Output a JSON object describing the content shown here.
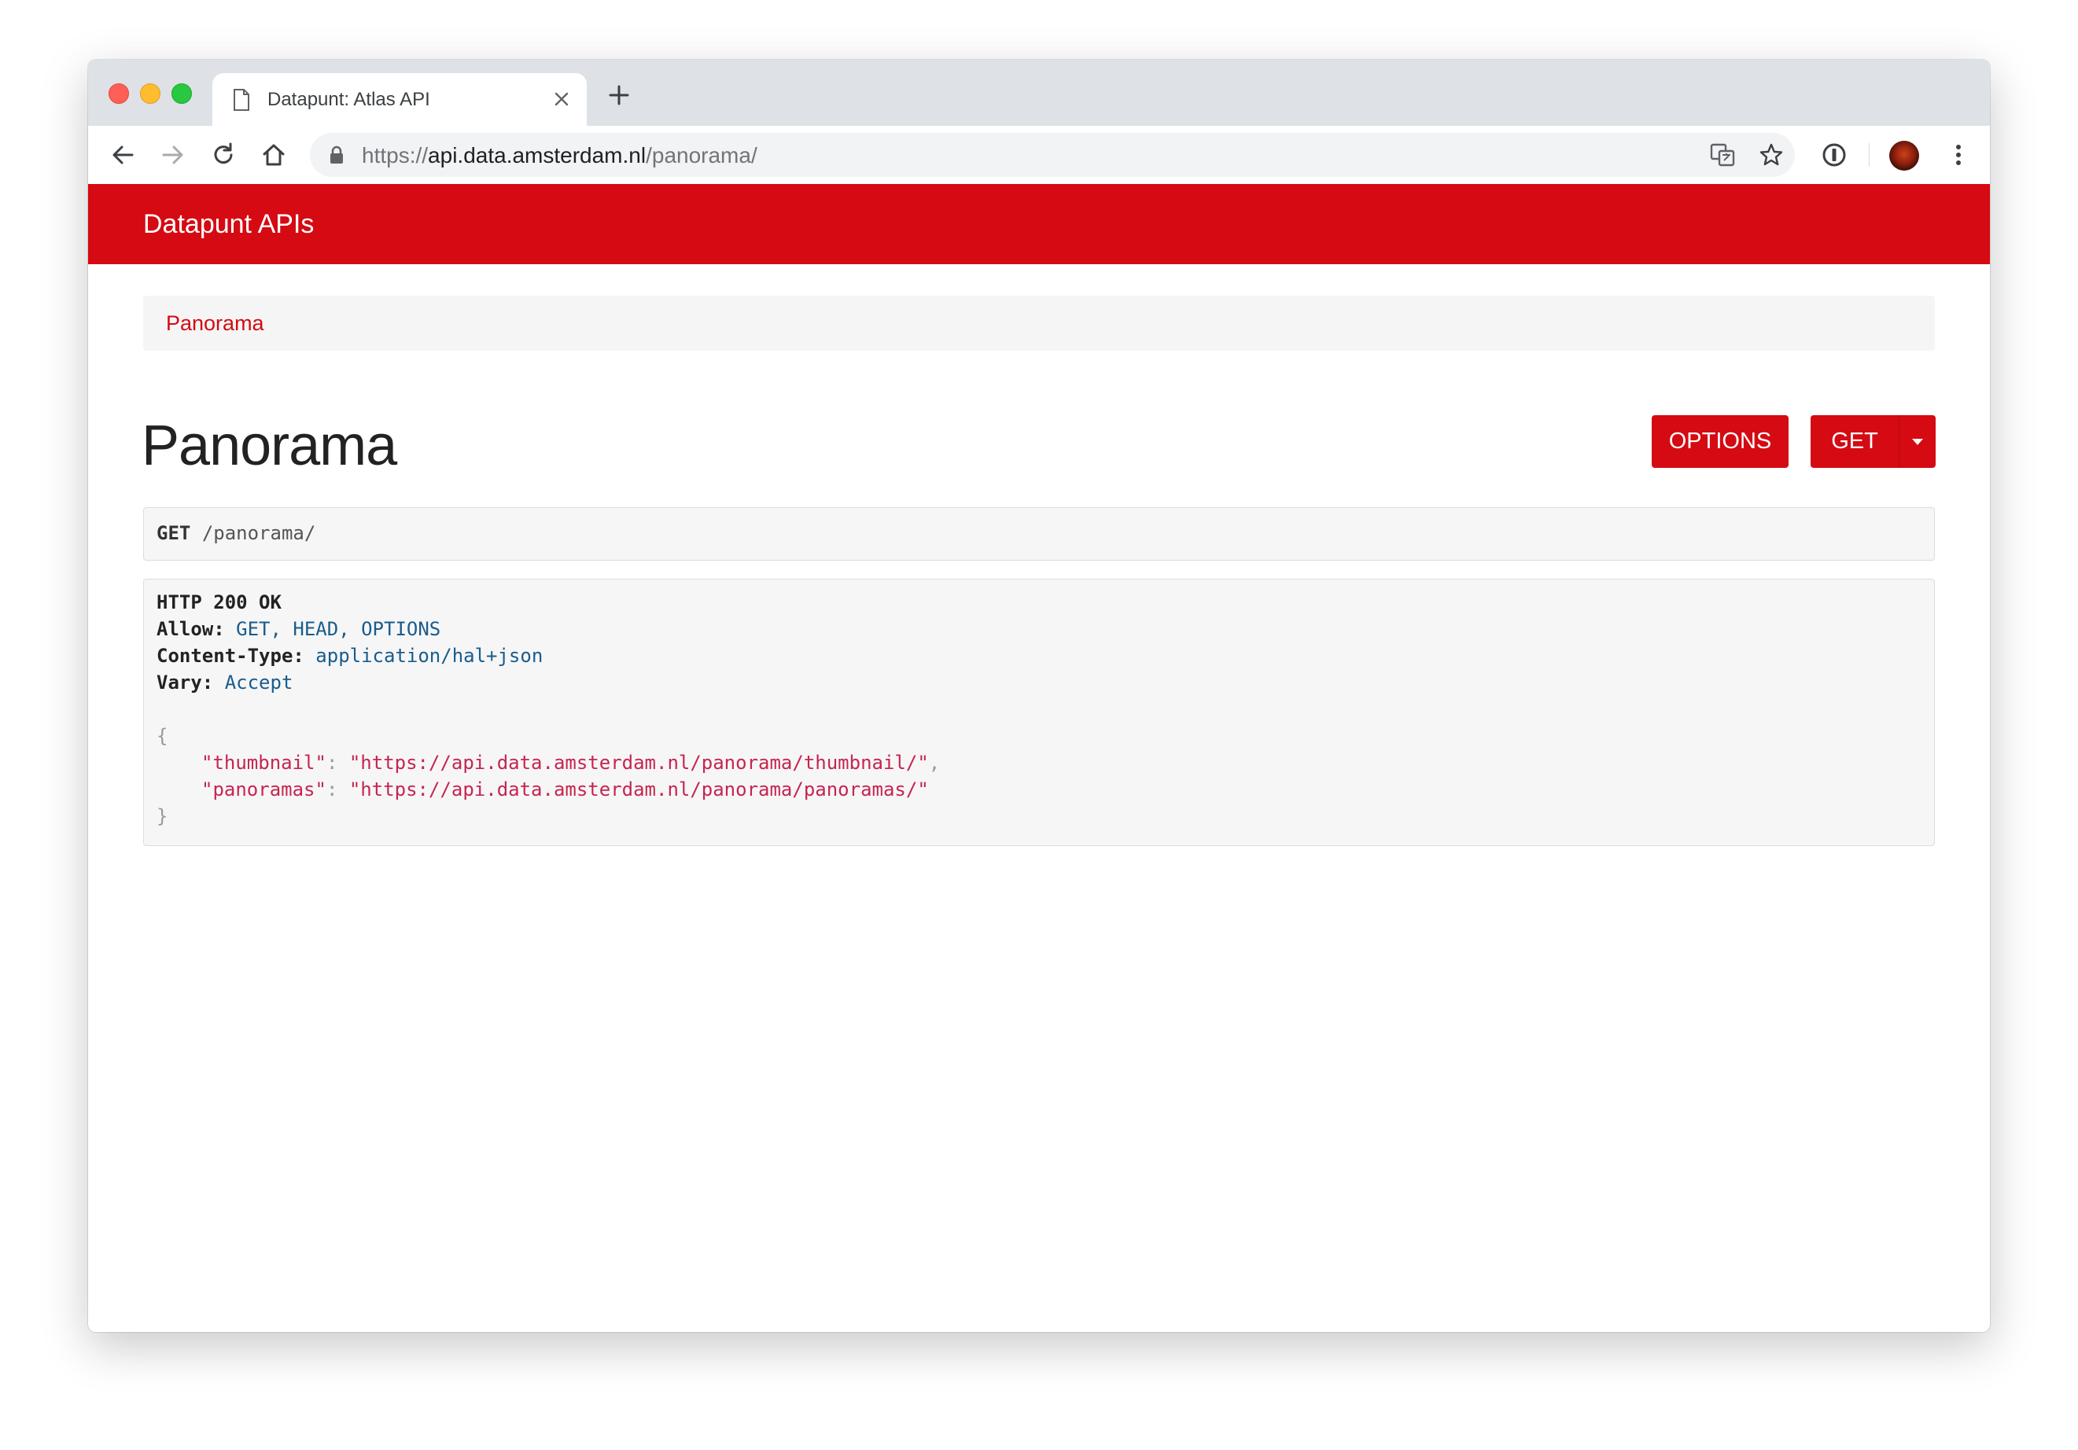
{
  "browser": {
    "tab_title": "Datapunt: Atlas API",
    "url": {
      "scheme": "https://",
      "host": "api.data.amsterdam.nl",
      "path": "/panorama/"
    }
  },
  "navbar": {
    "brand": "Datapunt APIs"
  },
  "breadcrumb": {
    "item": "Panorama"
  },
  "page": {
    "title": "Panorama",
    "options_label": "OPTIONS",
    "get_label": "GET"
  },
  "request": {
    "method": "GET",
    "path": "/panorama/"
  },
  "response": {
    "status": "HTTP 200 OK",
    "headers": [
      {
        "name": "Allow:",
        "value": "GET, HEAD, OPTIONS"
      },
      {
        "name": "Content-Type:",
        "value": "application/hal+json"
      },
      {
        "name": "Vary:",
        "value": "Accept"
      }
    ],
    "body": {
      "open": "{",
      "close": "}",
      "entries": [
        {
          "key": "\"thumbnail\"",
          "value": "\"https://api.data.amsterdam.nl/panorama/thumbnail/\"",
          "comma": ","
        },
        {
          "key": "\"panoramas\"",
          "value": "\"https://api.data.amsterdam.nl/panorama/panoramas/\"",
          "comma": ""
        }
      ]
    }
  },
  "colors": {
    "brand_red": "#d50a12",
    "string_red": "#c7254e",
    "meta_blue": "#1a5c8b"
  }
}
